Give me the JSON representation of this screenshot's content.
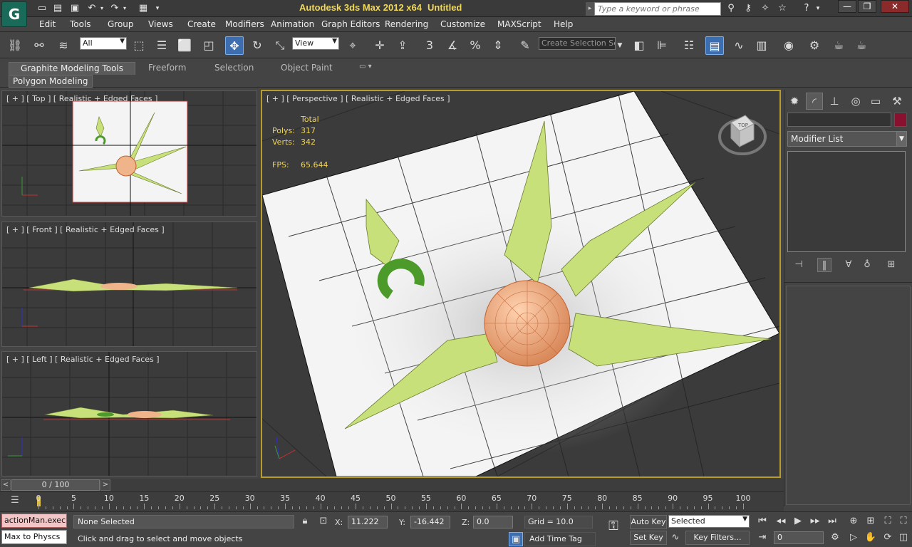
{
  "window": {
    "app_title": "Autodesk 3ds Max  2012 x64",
    "doc_title": "Untitled",
    "search_placeholder": "Type a keyword or phrase",
    "minimize": "—",
    "maximize": "❐",
    "close": "✕"
  },
  "menu": {
    "items": [
      "Edit",
      "Tools",
      "Group",
      "Views",
      "Create",
      "Modifiers",
      "Animation",
      "Graph Editors",
      "Rendering",
      "Customize",
      "MAXScript",
      "Help"
    ]
  },
  "toolbar": {
    "selection_filter": "All",
    "ref_coord": "View",
    "snap_3": "3",
    "named_selection_placeholder": "Create Selection Se"
  },
  "ribbon": {
    "tabs": [
      "Graphite Modeling Tools",
      "Freeform",
      "Selection",
      "Object Paint"
    ],
    "active_tab": "Graphite Modeling Tools",
    "panel_label": "Polygon Modeling"
  },
  "viewports": {
    "top": "[ + ] [ Top ] [ Realistic + Edged Faces ]",
    "front": "[ + ] [ Front ] [ Realistic + Edged Faces ]",
    "left": "[ + ] [ Left ] [ Realistic + Edged Faces ]",
    "perspective": "[ + ] [ Perspective ] [ Realistic + Edged Faces ]",
    "viewcube_label": "TOP"
  },
  "stats": {
    "header": "Total",
    "polys_label": "Polys:",
    "polys_value": "317",
    "verts_label": "Verts:",
    "verts_value": "342",
    "fps_label": "FPS:",
    "fps_value": "65.644"
  },
  "command_panel": {
    "modifier_list": "Modifier List"
  },
  "timeline": {
    "frame_display": "0 / 100",
    "prev": "<",
    "next": ">",
    "ticks": [
      "0",
      "5",
      "10",
      "15",
      "20",
      "25",
      "30",
      "35",
      "40",
      "45",
      "50",
      "55",
      "60",
      "65",
      "70",
      "75",
      "80",
      "85",
      "90",
      "95",
      "100"
    ]
  },
  "status": {
    "script_line_1": "actionMan.execu",
    "script_line_2": "Max to Physcs",
    "selection": "None Selected",
    "prompt": "Click and drag to select and move objects",
    "x_label": "X:",
    "x_value": "11.222",
    "y_label": "Y:",
    "y_value": "-16.442",
    "z_label": "Z:",
    "z_value": "0.0",
    "grid": "Grid = 10.0",
    "add_time_tag": "Add Time Tag",
    "auto_key": "Auto Key",
    "set_key": "Set Key",
    "key_mode": "Selected",
    "key_filters": "Key Filters...",
    "current_frame": "0"
  },
  "colors": {
    "leaf": "#c8e07a",
    "center": "#f0b48a",
    "ring": "#4c9a2a",
    "viewport_border": "#b89b2a"
  }
}
